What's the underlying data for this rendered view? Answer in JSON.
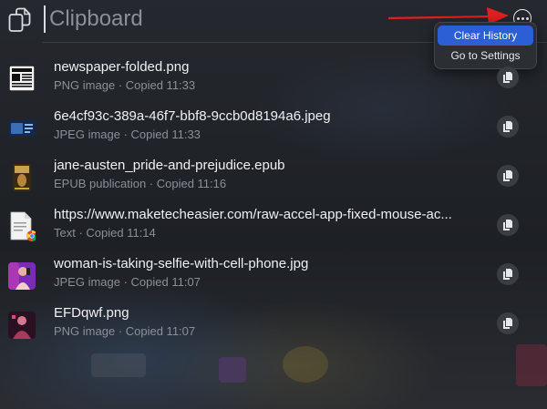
{
  "search": {
    "placeholder": "Clipboard"
  },
  "menu": {
    "items": [
      {
        "label": "Clear History"
      },
      {
        "label": "Go to Settings"
      }
    ]
  },
  "items": [
    {
      "title": "newspaper-folded.png",
      "subtitle": "PNG image · Copied 11:33",
      "thumb": "newspaper-icon"
    },
    {
      "title": "6e4cf93c-389a-46f7-bbf8-9ccb0d8194a6.jpeg",
      "subtitle": "JPEG image · Copied 11:33",
      "thumb": "image-thumbnail"
    },
    {
      "title": "jane-austen_pride-and-prejudice.epub",
      "subtitle": "EPUB publication · Copied 11:16",
      "thumb": "book-cover-thumbnail"
    },
    {
      "title": "https://www.maketecheasier.com/raw-accel-app-fixed-mouse-ac...",
      "subtitle": "Text · Copied 11:14",
      "thumb": "text-document-icon"
    },
    {
      "title": "woman-is-taking-selfie-with-cell-phone.jpg",
      "subtitle": "JPEG image · Copied 11:07",
      "thumb": "photo-thumbnail"
    },
    {
      "title": "EFDqwf.png",
      "subtitle": "PNG image · Copied 11:07",
      "thumb": "photo-thumbnail"
    }
  ],
  "colors": {
    "accent": "#2c5ed6",
    "annotation_arrow": "#e02020",
    "text_primary": "#eef0f3",
    "text_secondary": "#8b9097"
  }
}
